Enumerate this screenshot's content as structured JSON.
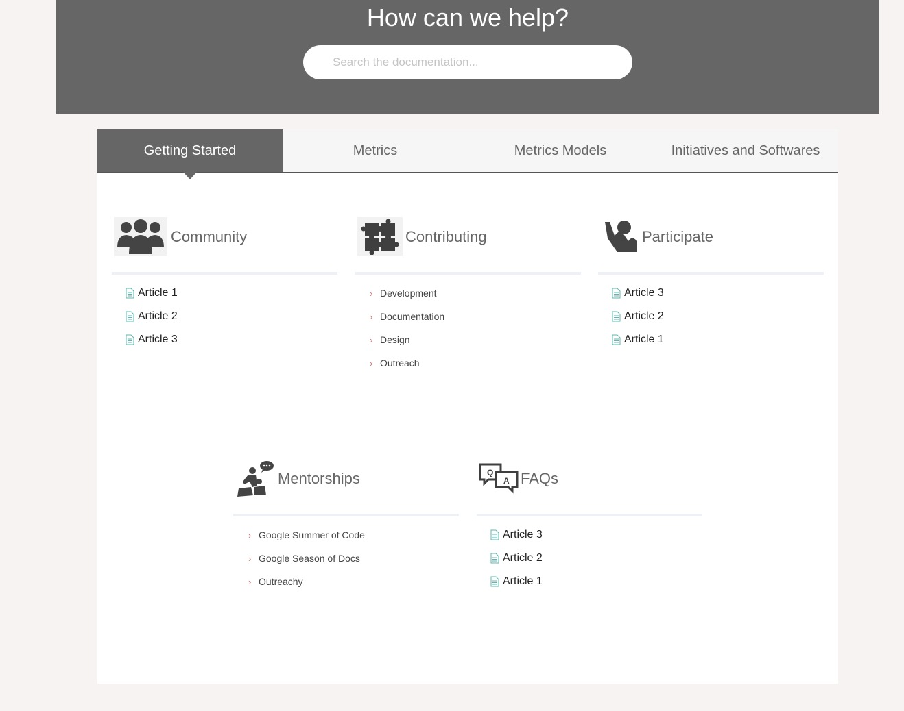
{
  "hero": {
    "heading": "How can we help?",
    "search_placeholder": "Search the documentation..."
  },
  "tabs": [
    {
      "label": "Getting Started",
      "active": true
    },
    {
      "label": "Metrics",
      "active": false
    },
    {
      "label": "Metrics Models",
      "active": false
    },
    {
      "label": "Initiatives and Softwares",
      "active": false
    }
  ],
  "categories": {
    "community": {
      "title": "Community",
      "icon": "group-icon",
      "articles": [
        "Article 1",
        "Article 2",
        "Article 3"
      ]
    },
    "contributing": {
      "title": "Contributing",
      "icon": "puzzle-icon",
      "subcategories": [
        "Development",
        "Documentation",
        "Design",
        "Outreach"
      ]
    },
    "participate": {
      "title": "Participate",
      "icon": "raised-hand-icon",
      "articles": [
        "Article 3",
        "Article 2",
        "Article 1"
      ]
    },
    "mentorships": {
      "title": "Mentorships",
      "icon": "mentor-icon",
      "subcategories": [
        "Google Summer of Code",
        "Google Season of Docs",
        "Outreachy"
      ]
    },
    "faqs": {
      "title": "FAQs",
      "icon": "qa-icon",
      "articles": [
        "Article 3",
        "Article 2",
        "Article 1"
      ]
    }
  },
  "colors": {
    "hero_bg": "#666666",
    "page_bg": "#f6f3f2",
    "doc_icon": "#5bb8b0",
    "chevron": "#d07a7a"
  }
}
